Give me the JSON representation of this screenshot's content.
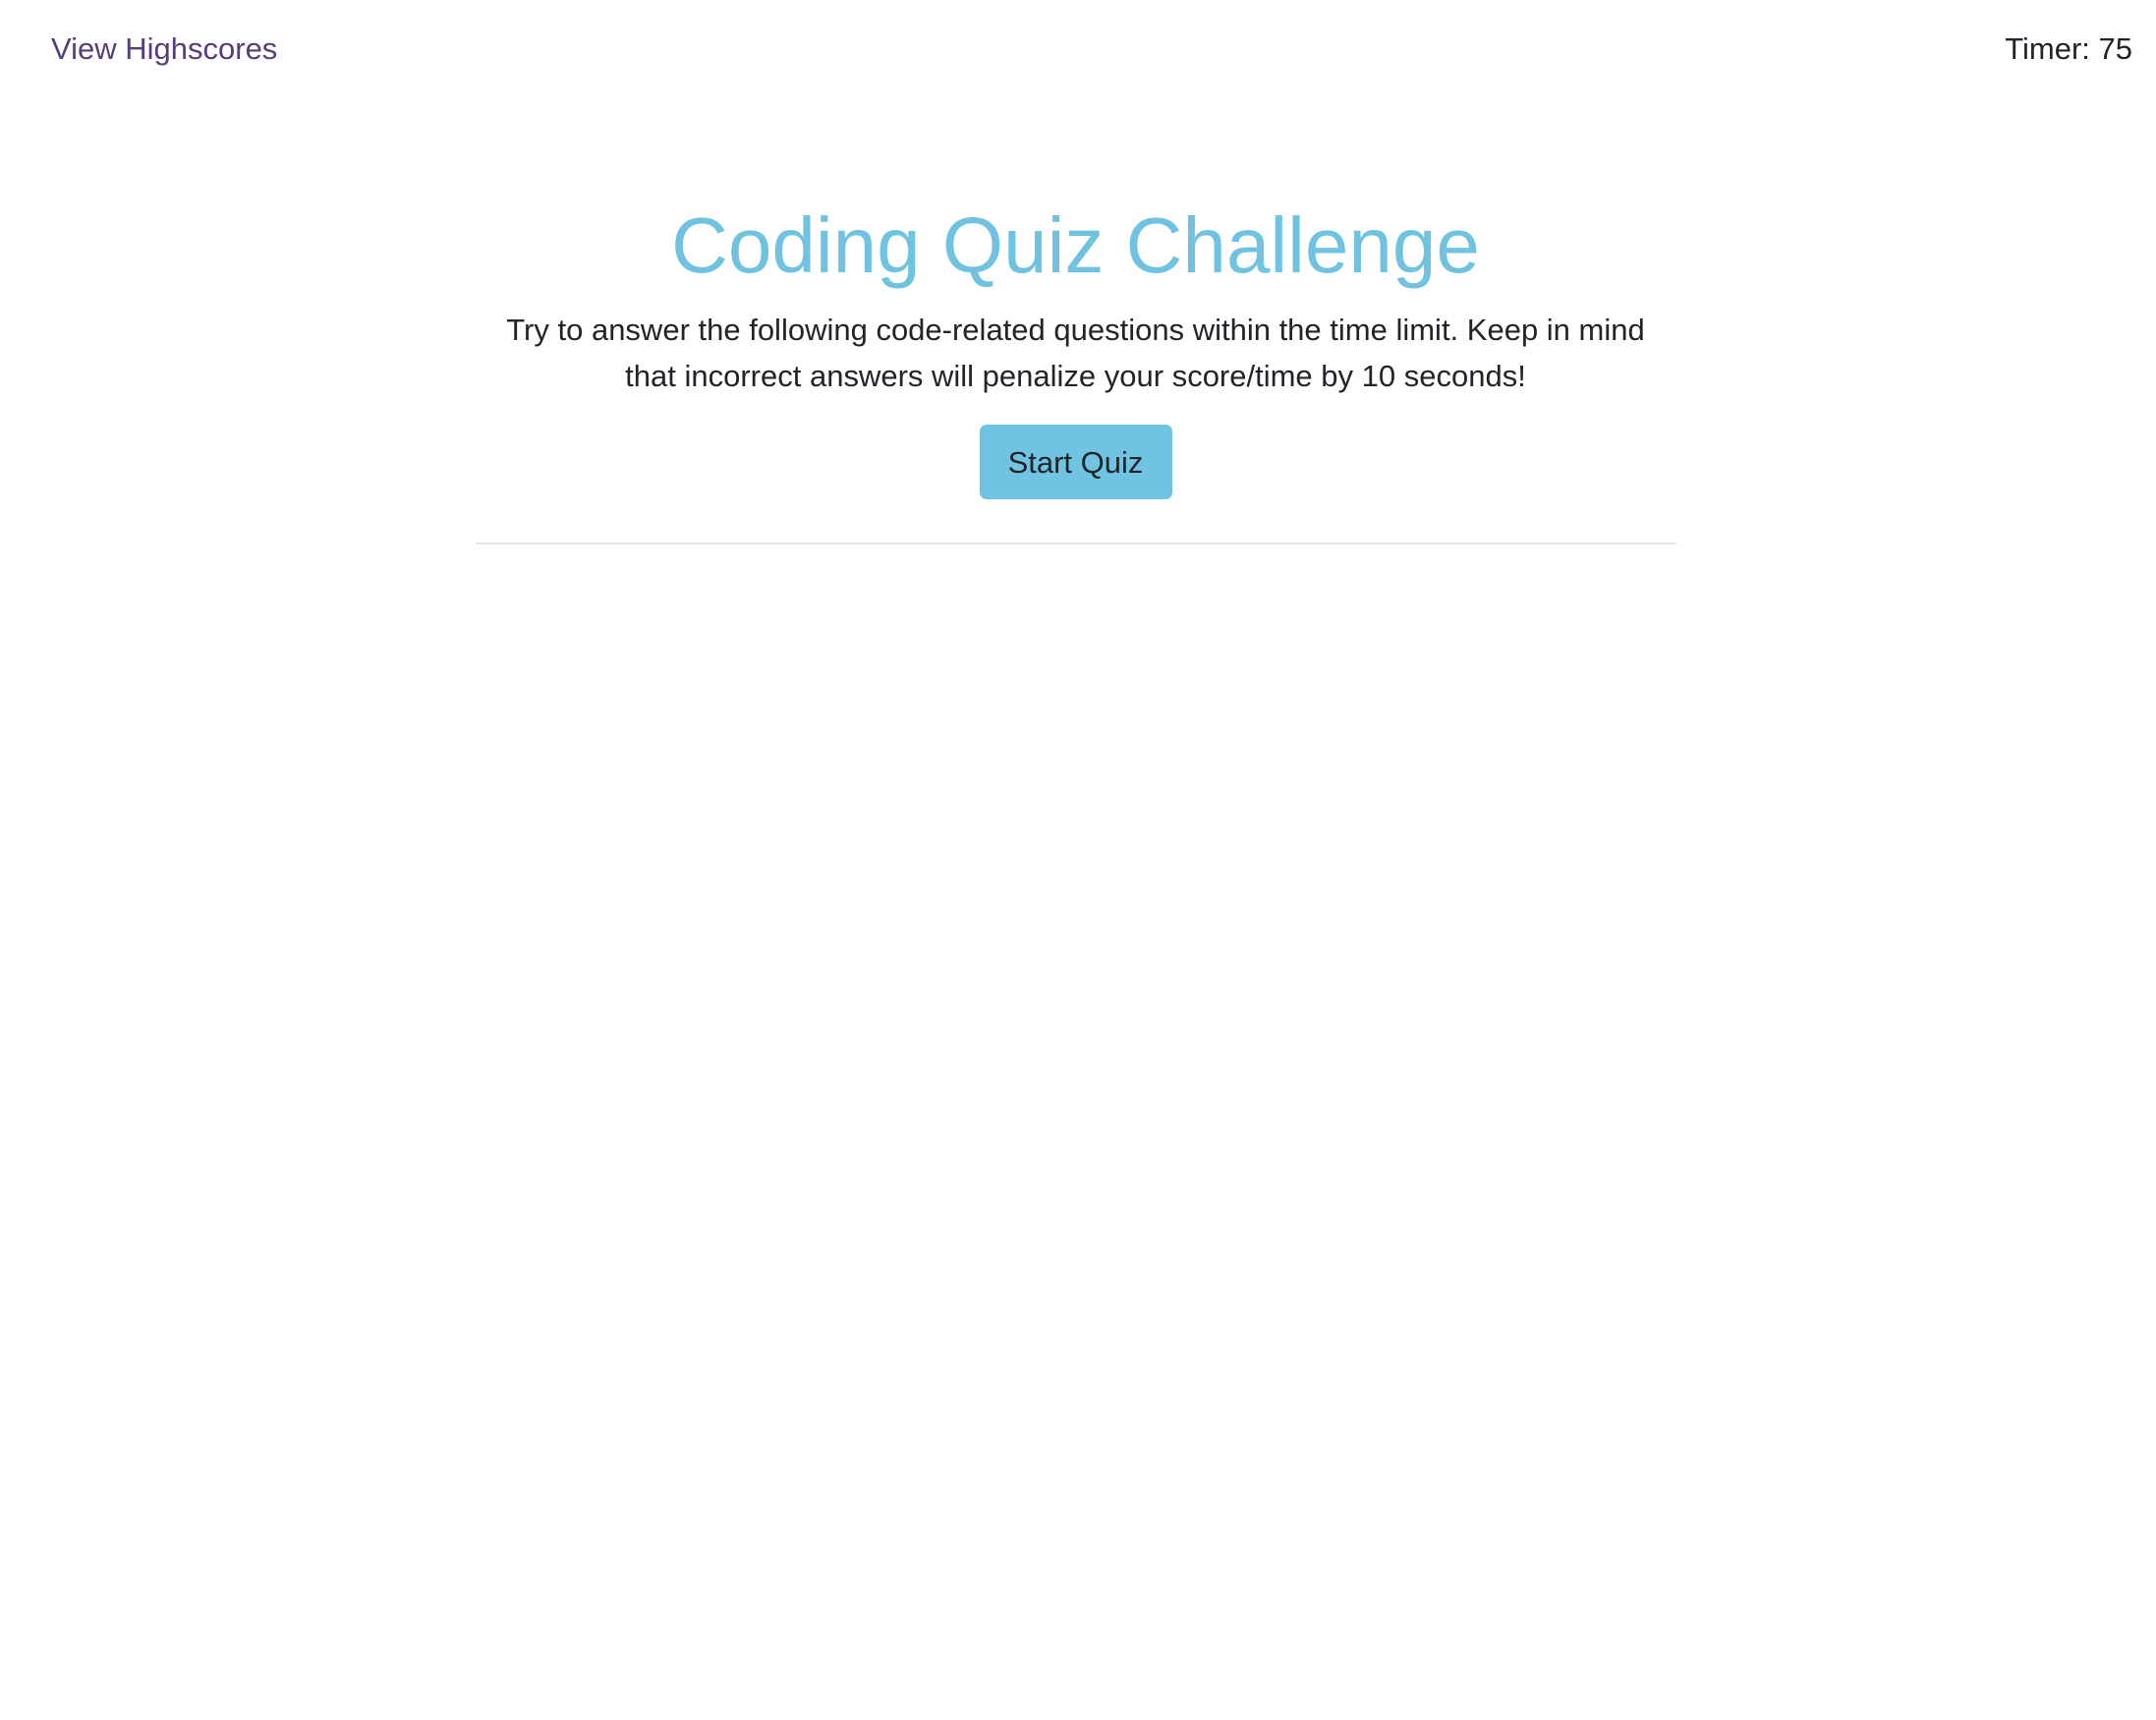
{
  "header": {
    "highscores_link": "View Highscores",
    "timer": "Timer: 75"
  },
  "main": {
    "title": "Coding Quiz Challenge",
    "description": "Try to answer the following code-related questions within the time limit. Keep in mind that incorrect answers will penalize your score/time by 10 seconds!",
    "start_button": "Start Quiz"
  },
  "colors": {
    "accent": "#6fc3e1",
    "link": "#563d7c"
  }
}
